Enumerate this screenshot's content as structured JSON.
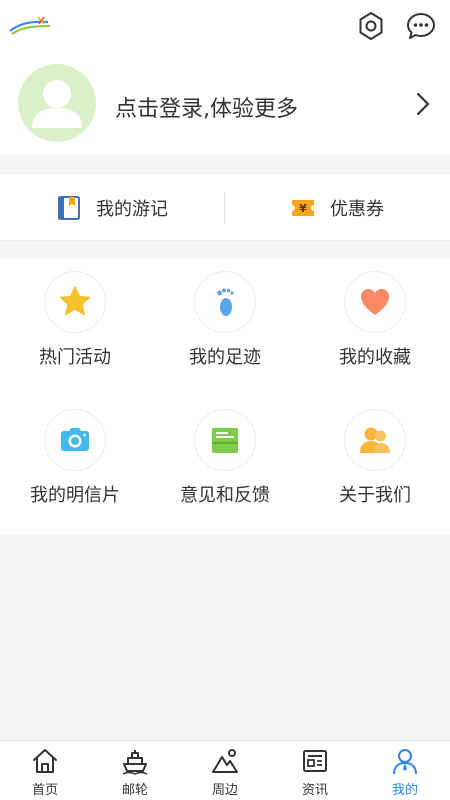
{
  "header": {
    "settings_icon": "gear-icon",
    "message_icon": "chat-bubble-icon"
  },
  "profile": {
    "login_prompt": "点击登录,体验更多",
    "avatar_icon": "user-avatar-icon",
    "avatar_bg": "#d9f0c8"
  },
  "quick_links": [
    {
      "label": "我的游记",
      "icon": "book-icon"
    },
    {
      "label": "优惠券",
      "icon": "coupon-icon"
    }
  ],
  "grid": [
    {
      "label": "热门活动",
      "icon": "star-icon"
    },
    {
      "label": "我的足迹",
      "icon": "footprint-icon"
    },
    {
      "label": "我的收藏",
      "icon": "heart-icon"
    },
    {
      "label": "我的明信片",
      "icon": "camera-icon"
    },
    {
      "label": "意见和反馈",
      "icon": "feedback-icon"
    },
    {
      "label": "关于我们",
      "icon": "users-icon"
    }
  ],
  "tabs": [
    {
      "label": "首页",
      "icon": "home-icon"
    },
    {
      "label": "邮轮",
      "icon": "cruise-ship-icon"
    },
    {
      "label": "周边",
      "icon": "mountain-icon"
    },
    {
      "label": "资讯",
      "icon": "news-icon"
    },
    {
      "label": "我的",
      "icon": "profile-icon",
      "active": true
    }
  ],
  "colors": {
    "accent": "#2d86e8",
    "star": "#f8c02b",
    "footprint": "#5aa6ea",
    "heart": "#fb8a66",
    "camera": "#43b8ec",
    "feedback": "#7ccc4a",
    "users": "#f7b53c",
    "coupon": "#f8a51b"
  }
}
